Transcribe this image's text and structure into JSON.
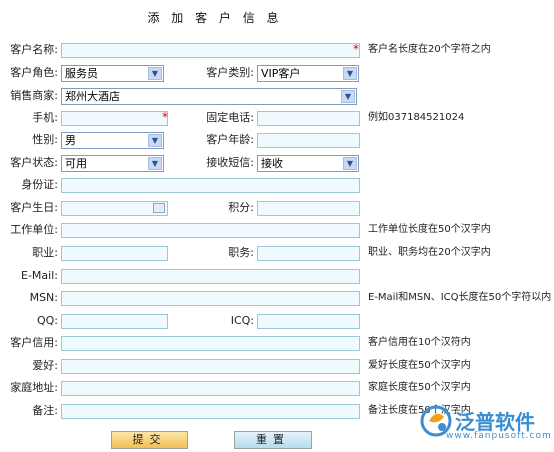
{
  "title": "添 加 客 户 信 息",
  "labels": {
    "customer_name": "客户名称:",
    "customer_role": "客户角色:",
    "customer_type": "客户类别:",
    "dealer": "销售商家:",
    "mobile": "手机:",
    "landline": "固定电话:",
    "gender": "性别:",
    "age": "客户年龄:",
    "status": "客户状态:",
    "sms": "接收短信:",
    "id_card": "身份证:",
    "birthday": "客户生日:",
    "points": "积分:",
    "work_unit": "工作单位:",
    "occupation": "职业:",
    "position": "职务:",
    "email": "E-Mail:",
    "msn": "MSN:",
    "qq": "QQ:",
    "icq": "ICQ:",
    "credit": "客户信用:",
    "hobby": "爱好:",
    "address": "家庭地址:",
    "remark": "备注:"
  },
  "selects": {
    "role": "服务员",
    "type": "VIP客户",
    "dealer": "郑州大酒店",
    "gender": "男",
    "status": "可用",
    "sms": "接收"
  },
  "hints": {
    "name": "客户名长度在20个字符之内",
    "phone": "例如037184521024",
    "work_unit": "工作单位长度在50个汉字内",
    "occupation": "职业、职务均在20个汉字内",
    "msn": "E-Mail和MSN、ICQ长度在50个字符以内",
    "credit": "客户信用在10个汉符内",
    "hobby": "爱好长度在50个汉字内",
    "address": "家庭长度在50个汉字内",
    "remark": "备注长度在50个汉字内"
  },
  "required_mark": "*",
  "buttons": {
    "submit": "提交",
    "reset": "重置"
  },
  "watermark": {
    "name": "泛普软件",
    "url": "www.fanpusoft.com"
  },
  "colors": {
    "input_bg": "#eefafd",
    "input_border": "#9cc8d8",
    "required": "#e00000",
    "logo": "#3d8ed0"
  }
}
